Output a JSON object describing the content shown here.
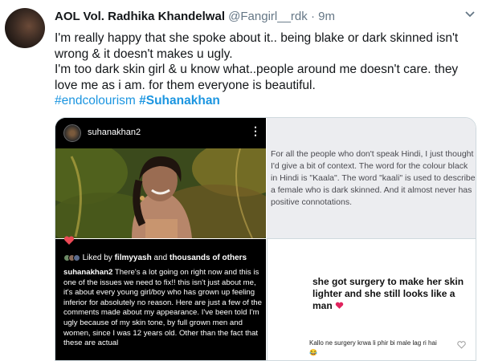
{
  "tweet": {
    "display_name": "AOL Vol. Radhika Khandelwal",
    "handle": "@Fangirl__rdk",
    "separator": "·",
    "time": "9m",
    "line1": "I'm really happy that she spoke about it.. being blake or dark skinned isn't wrong & it doesn't makes u ugly.",
    "line2": "I'm too dark skin girl & u know what..people around me doesn't care. they love me as i am. for them everyone is beautiful.",
    "hashtag1": "#endcolourism",
    "hashtag2": "#Suhanakhan"
  },
  "instagram_post": {
    "username": "suhanakhan2",
    "menu_icon": "more-vertical-icon",
    "liked_by_prefix": "Liked by",
    "liked_by_user": "filmyyash",
    "liked_by_suffix": "and",
    "liked_by_others": "thousands of others",
    "caption_user": "suhanakhan2",
    "caption_text": "There's a lot going on right now and this is one of the issues we need to fix!! this isn't just about me, it's about every young girl/boy who has grown up feeling inferior for absolutely no reason. Here are just a few of the comments made about my appearance. I've been told I'm ugly because of my skin tone, by full grown men and women, since I was 12 years old. Other than the fact that these are actual"
  },
  "context_card": {
    "text": "For all the people who don't speak Hindi, I just thought I'd give a bit of context. The word for the colour black in Hindi is \"Kaala\". The word \"kaali\" is used to describe a female who is dark skinned. And it almost never has positive connotations."
  },
  "comment_card": {
    "quote": "she got surgery to make her skin lighter and she still looks like a man",
    "emoji_icon": "red-heart-emoji",
    "comment": "Kallo ne surgery krwa li phir bi male lag ri hai 😂"
  },
  "colors": {
    "link": "#1b95e0",
    "muted": "#657786",
    "heart_red": "#e0245e"
  }
}
